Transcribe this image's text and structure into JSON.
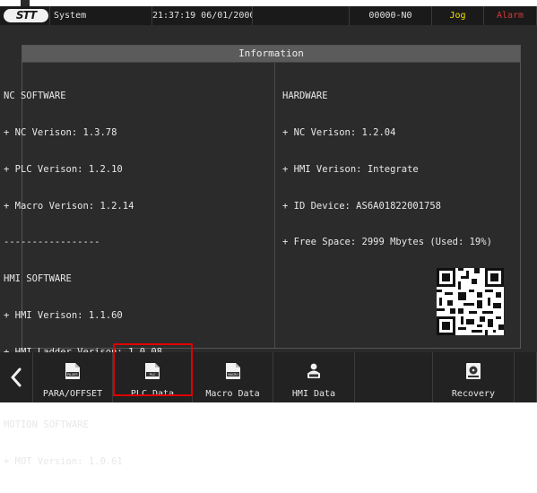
{
  "status_bar": {
    "title": "System",
    "clock": "21:37:19 06/01/2000",
    "code": "00000-N0",
    "jog": "Jog",
    "alarm": "Alarm",
    "colors": {
      "jog": "#f0e000",
      "alarm": "#d23a3a"
    }
  },
  "panel": {
    "title": "Information",
    "left_lines": [
      "NC SOFTWARE",
      "+ NC Verison: 1.3.78",
      "+ PLC Verison: 1.2.10",
      "+ Macro Verison: 1.2.14",
      "-----------------",
      "HMI SOFTWARE",
      "+ HMI Verison: 1.1.60",
      "+ HMI Ladder Verison: 1.0.08",
      "-----------------",
      "MOTION SOFTWARE",
      "+ MOT Version: 1.0.61"
    ],
    "right_lines": [
      "HARDWARE",
      "+ NC Verison: 1.2.04",
      "+ HMI Verison: Integrate",
      "+ ID Device: AS6A01822001758",
      "+ Free Space: 2999 Mbytes (Used: 19%)"
    ]
  },
  "bottom_bar": {
    "back_icon": "chevron-left-icon",
    "buttons": [
      {
        "label": "PARA/OFFSET",
        "icon_text": "PA.AFF.",
        "icon": "file-icon"
      },
      {
        "label": "PLC Data",
        "icon_text": "PLC",
        "icon": "file-icon",
        "selected": true
      },
      {
        "label": "Macro Data",
        "icon_text": "MACRO",
        "icon": "file-icon"
      },
      {
        "label": "HMI Data",
        "icon": "user-computer-icon"
      },
      {
        "label": "",
        "icon": ""
      },
      {
        "label": "Recovery",
        "icon": "recovery-disk-icon"
      }
    ],
    "selected_color": "#e00000"
  }
}
